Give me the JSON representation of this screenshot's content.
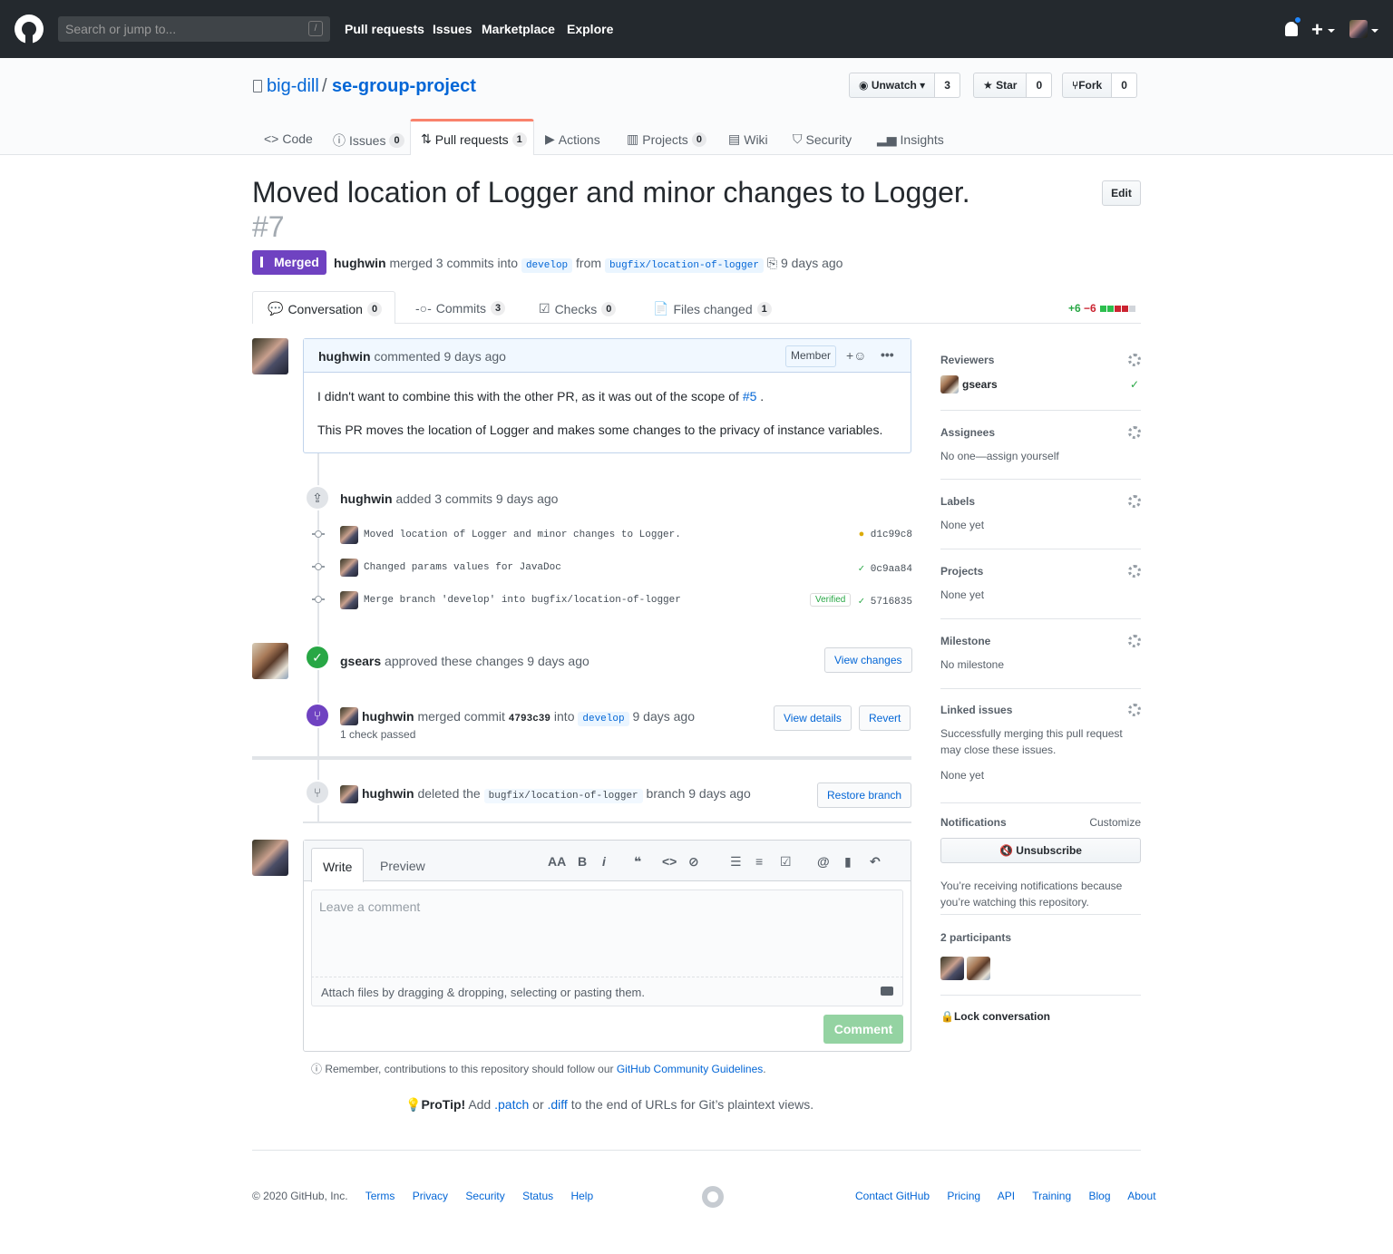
{
  "header": {
    "search_placeholder": "Search or jump to...",
    "slash": "/",
    "nav": [
      "Pull requests",
      "Issues",
      "Marketplace",
      "Explore"
    ],
    "plus": "+"
  },
  "repo": {
    "owner": "big-dill",
    "sep": "/",
    "name": "se-group-project",
    "unwatch_label": "Unwatch",
    "watch_count": "3",
    "star_label": "Star",
    "star_count": "0",
    "fork_label": "Fork",
    "fork_count": "0"
  },
  "repo_tabs": [
    {
      "label": "Code",
      "count": ""
    },
    {
      "label": "Issues",
      "count": "0"
    },
    {
      "label": "Pull requests",
      "count": "1"
    },
    {
      "label": "Actions",
      "count": ""
    },
    {
      "label": "Projects",
      "count": "0"
    },
    {
      "label": "Wiki",
      "count": ""
    },
    {
      "label": "Security",
      "count": ""
    },
    {
      "label": "Insights",
      "count": ""
    }
  ],
  "pr": {
    "title": "Moved location of Logger and minor changes to Logger.",
    "number": "#7",
    "edit_label": "Edit",
    "state": "Merged",
    "author": "hughwin",
    "merged_text": "merged 3 commits into",
    "base_branch": "develop",
    "from_text": "from",
    "head_branch": "bugfix/location-of-logger",
    "time": "9 days ago"
  },
  "pr_tabs": [
    {
      "label": "Conversation",
      "count": "0"
    },
    {
      "label": "Commits",
      "count": "3"
    },
    {
      "label": "Checks",
      "count": "0"
    },
    {
      "label": "Files changed",
      "count": "1"
    }
  ],
  "diffstat": {
    "added": "+6",
    "removed": "−6",
    "colors": [
      "#2cbe4e",
      "#2cbe4e",
      "#cb2431",
      "#cb2431",
      "#d1d5da"
    ]
  },
  "comment": {
    "author": "hughwin",
    "header_text": "commented 9 days ago",
    "role": "Member",
    "emoji_icon": "+☺",
    "more_icon": "•••",
    "para1": "I didn't want to combine this with the other PR, as it was out of the scope of",
    "link": "#5",
    "para1_end": ".",
    "para2": "This PR moves the location of Logger and makes some changes to the privacy of instance variables."
  },
  "timeline": {
    "commits_author": "hughwin",
    "commits_text": "added 3 commits 9 days ago",
    "commits": [
      {
        "msg": "Moved location of Logger and minor changes to Logger.",
        "sha": "d1c99c8",
        "status": "pending"
      },
      {
        "msg": "Changed params values for JavaDoc",
        "sha": "0c9aa84",
        "status": "ok"
      },
      {
        "msg": "Merge branch 'develop' into bugfix/location-of-logger",
        "sha": "5716835",
        "status": "ok",
        "verified": "Verified"
      }
    ],
    "approve_author": "gsears",
    "approve_text": "approved these changes 9 days ago",
    "view_changes": "View changes",
    "merge_author": "hughwin",
    "merge_text1": "merged commit",
    "merge_sha": "4793c39",
    "merge_text2": "into",
    "merge_branch": "develop",
    "merge_time": "9 days ago",
    "checks": "1 check passed",
    "view_details": "View details",
    "revert": "Revert",
    "delete_author": "hughwin",
    "delete_text": "deleted the",
    "delete_branch": "bugfix/location-of-logger",
    "delete_time": "branch 9 days ago",
    "restore": "Restore branch"
  },
  "form": {
    "write": "Write",
    "preview": "Preview",
    "tools": [
      "AA",
      "B",
      "i",
      "❝",
      "<>",
      "⊘",
      "☰",
      "≡",
      "☑",
      "@",
      "▮",
      "↶"
    ],
    "placeholder": "Leave a comment",
    "attach": "Attach files by dragging & dropping, selecting or pasting them.",
    "submit": "Comment",
    "remember": "Remember, contributions to this repository should follow our",
    "guidelines": "GitHub Community Guidelines",
    "remember_end": ".",
    "protip_label": "ProTip!",
    "protip_1": "Add",
    "patch": ".patch",
    "protip_2": "or",
    "diff": ".diff",
    "protip_3": "to the end of URLs for Git’s plaintext views."
  },
  "sidebar": {
    "reviewers": "Reviewers",
    "reviewer_name": "gsears",
    "assignees": "Assignees",
    "assignees_val": "No one—assign yourself",
    "labels": "Labels",
    "labels_val": "None yet",
    "projects": "Projects",
    "projects_val": "None yet",
    "milestone": "Milestone",
    "milestone_val": "No milestone",
    "linked": "Linked issues",
    "linked_desc": "Successfully merging this pull request may close these issues.",
    "linked_val": "None yet",
    "notifications": "Notifications",
    "customize": "Customize",
    "unsubscribe": "Unsubscribe",
    "notif_desc": "You’re receiving notifications because you’re watching this repository.",
    "participants": "2 participants",
    "lock": "Lock conversation"
  },
  "footer": {
    "copyright": "© 2020 GitHub, Inc.",
    "left_links": [
      "Terms",
      "Privacy",
      "Security",
      "Status",
      "Help"
    ],
    "right_links": [
      "Contact GitHub",
      "Pricing",
      "API",
      "Training",
      "Blog",
      "About"
    ]
  }
}
